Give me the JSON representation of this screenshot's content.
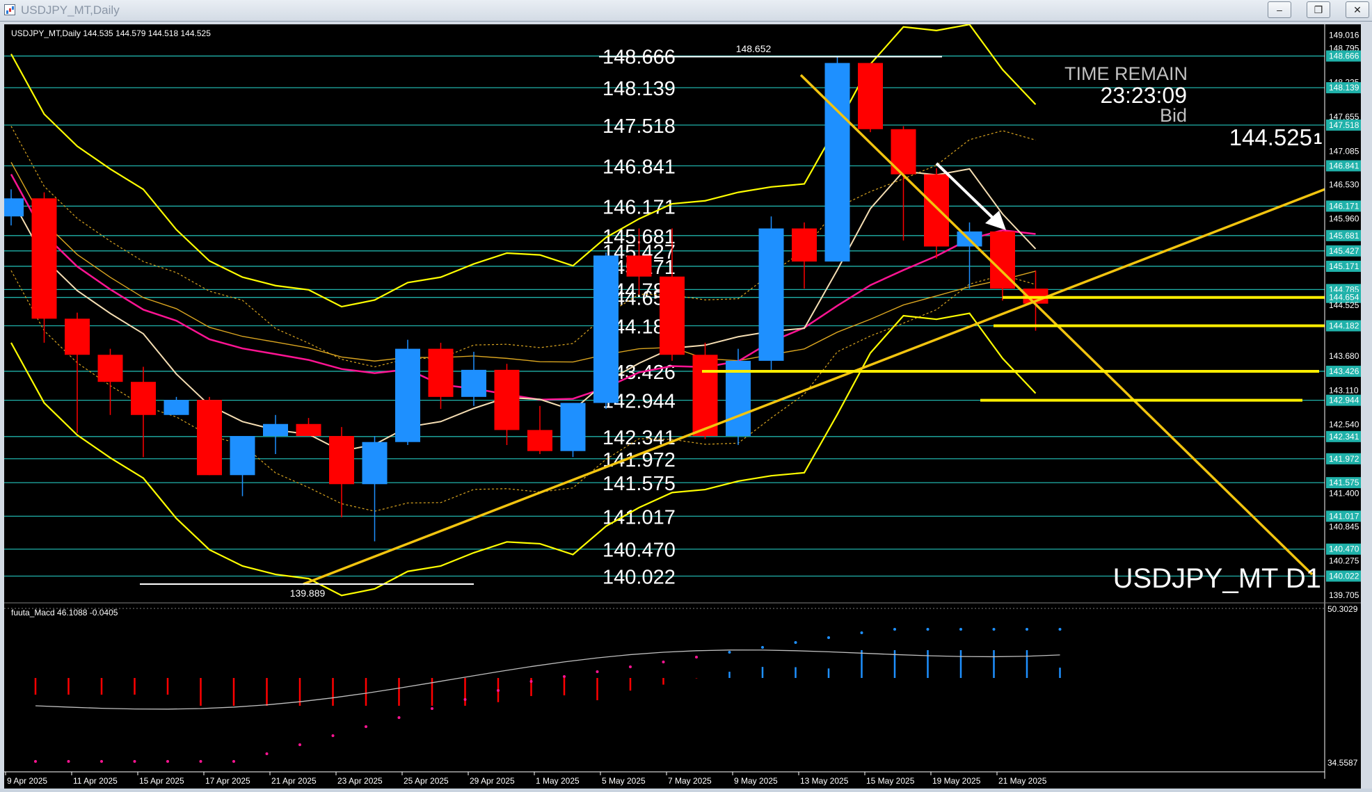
{
  "window": {
    "title": "USDJPY_MT,Daily",
    "buttons": {
      "minimize": "‒",
      "restore": "❐",
      "close": "✕"
    }
  },
  "chart_info": {
    "ohlc_line": "USDJPY_MT,Daily  144.535 144.579 144.518 144.525",
    "symbol_big": "USDJPY_MT D1",
    "time_remain_label": "TIME REMAIN",
    "time_remain": "23:23:09",
    "bid_label": "Bid",
    "bid_value": "144.525",
    "bid_digit": "1",
    "high_marker": "148.652",
    "low_marker": "139.889"
  },
  "macd_info": {
    "label": "fuuta_Macd 46.1088  -0.0405",
    "scale_top": "50.3029",
    "scale_bottom": "34.5587"
  },
  "colors": {
    "background": "#000000",
    "up_candle": "#1e90ff",
    "down_candle": "#ff0000",
    "level_line": "#20b2aa",
    "trend_line": "#ffd700",
    "bollinger": "#ffff00",
    "ma_white": "#f5deb3",
    "ma_magenta": "#ff1493",
    "ma_gold": "#daa520"
  },
  "chart_data": {
    "type": "candlestick",
    "x_labels": [
      "9 Apr 2025",
      "11 Apr 2025",
      "15 Apr 2025",
      "17 Apr 2025",
      "21 Apr 2025",
      "23 Apr 2025",
      "25 Apr 2025",
      "29 Apr 2025",
      "1 May 2025",
      "5 May 2025",
      "7 May 2025",
      "9 May 2025",
      "13 May 2025",
      "15 May 2025",
      "19 May 2025",
      "21 May 2025"
    ],
    "y_ticks": [
      "149.016",
      "148.795",
      "148.666",
      "148.225",
      "148.139",
      "147.655",
      "147.518",
      "147.085",
      "146.841",
      "146.530",
      "146.171",
      "145.960",
      "145.681",
      "145.427",
      "145.171",
      "144.785",
      "144.654",
      "144.525",
      "144.182",
      "143.680",
      "143.426",
      "143.110",
      "142.944",
      "142.540",
      "142.341",
      "141.972",
      "141.575",
      "141.400",
      "141.017",
      "140.845",
      "140.470",
      "140.275",
      "140.022",
      "139.705"
    ],
    "ylim": [
      139.6,
      149.1
    ],
    "level_labels": [
      "148.666",
      "148.139",
      "147.518",
      "146.841",
      "146.171",
      "145.681",
      "145.427",
      "145.171",
      "144.785",
      "144.654",
      "144.182",
      "143.426",
      "142.944",
      "142.341",
      "141.972",
      "141.575",
      "141.017",
      "140.470",
      "140.022"
    ],
    "candles": [
      {
        "o": 146.0,
        "h": 146.45,
        "l": 145.85,
        "c": 146.3
      },
      {
        "o": 146.3,
        "h": 146.4,
        "l": 143.9,
        "c": 144.3
      },
      {
        "o": 144.3,
        "h": 144.4,
        "l": 142.4,
        "c": 143.7
      },
      {
        "o": 143.7,
        "h": 143.8,
        "l": 142.7,
        "c": 143.25
      },
      {
        "o": 143.25,
        "h": 143.5,
        "l": 142.0,
        "c": 142.7
      },
      {
        "o": 142.7,
        "h": 143.0,
        "l": 142.8,
        "c": 142.95
      },
      {
        "o": 142.95,
        "h": 143.0,
        "l": 141.7,
        "c": 141.7
      },
      {
        "o": 141.7,
        "h": 142.2,
        "l": 141.35,
        "c": 142.35
      },
      {
        "o": 142.35,
        "h": 142.7,
        "l": 142.05,
        "c": 142.55
      },
      {
        "o": 142.55,
        "h": 142.65,
        "l": 142.35,
        "c": 142.35
      },
      {
        "o": 142.35,
        "h": 142.5,
        "l": 141.0,
        "c": 141.55
      },
      {
        "o": 141.55,
        "h": 142.35,
        "l": 140.6,
        "c": 142.25
      },
      {
        "o": 142.25,
        "h": 143.95,
        "l": 142.2,
        "c": 143.8
      },
      {
        "o": 143.8,
        "h": 143.9,
        "l": 142.8,
        "c": 143.0
      },
      {
        "o": 143.0,
        "h": 143.75,
        "l": 142.85,
        "c": 143.45
      },
      {
        "o": 143.45,
        "h": 143.55,
        "l": 142.2,
        "c": 142.45
      },
      {
        "o": 142.45,
        "h": 142.85,
        "l": 142.05,
        "c": 142.1
      },
      {
        "o": 142.1,
        "h": 142.9,
        "l": 142.0,
        "c": 142.9
      },
      {
        "o": 142.9,
        "h": 145.4,
        "l": 142.8,
        "c": 145.35
      },
      {
        "o": 145.35,
        "h": 145.8,
        "l": 144.7,
        "c": 145.0
      },
      {
        "o": 145.0,
        "h": 145.8,
        "l": 143.6,
        "c": 143.7
      },
      {
        "o": 143.7,
        "h": 143.9,
        "l": 142.3,
        "c": 142.35
      },
      {
        "o": 142.35,
        "h": 143.8,
        "l": 142.2,
        "c": 143.6
      },
      {
        "o": 143.6,
        "h": 146.0,
        "l": 143.45,
        "c": 145.8
      },
      {
        "o": 145.8,
        "h": 145.9,
        "l": 144.8,
        "c": 145.25
      },
      {
        "o": 145.25,
        "h": 148.65,
        "l": 145.3,
        "c": 148.55
      },
      {
        "o": 148.55,
        "h": 148.55,
        "l": 147.4,
        "c": 147.45
      },
      {
        "o": 147.45,
        "h": 147.5,
        "l": 145.6,
        "c": 146.7
      },
      {
        "o": 146.7,
        "h": 146.8,
        "l": 145.3,
        "c": 145.5
      },
      {
        "o": 145.5,
        "h": 145.9,
        "l": 144.8,
        "c": 145.75
      },
      {
        "o": 145.75,
        "h": 145.2,
        "l": 144.6,
        "c": 144.8
      },
      {
        "o": 144.8,
        "h": 145.1,
        "l": 144.1,
        "c": 144.55
      }
    ]
  }
}
